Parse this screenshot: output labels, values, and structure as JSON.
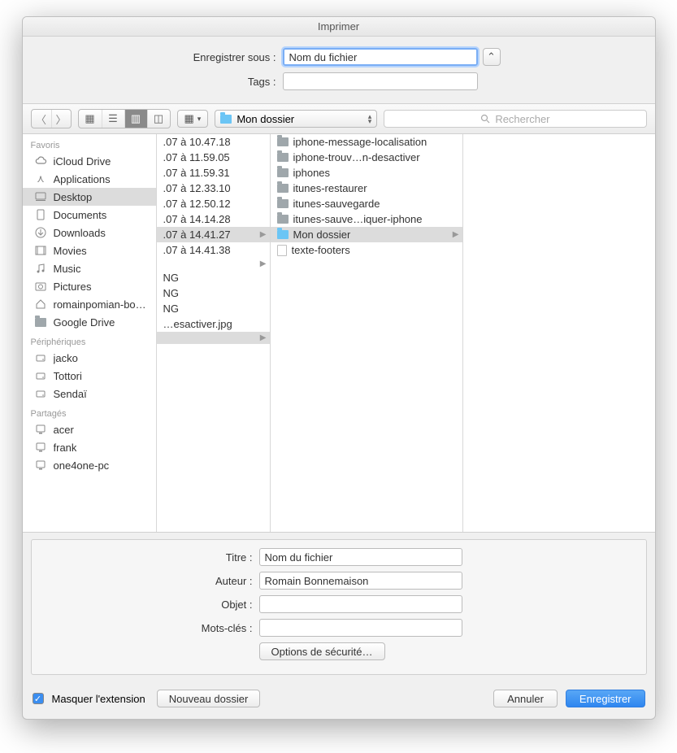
{
  "window": {
    "title": "Imprimer"
  },
  "save": {
    "label": "Enregistrer sous :",
    "filename": "Nom du fichier",
    "tags_label": "Tags :",
    "tags_value": ""
  },
  "toolbar": {
    "current_folder": "Mon dossier",
    "search_placeholder": "Rechercher"
  },
  "sidebar": {
    "sections": [
      {
        "heading": "Favoris",
        "items": [
          {
            "icon": "cloud",
            "label": "iCloud Drive"
          },
          {
            "icon": "apps",
            "label": "Applications"
          },
          {
            "icon": "desktop",
            "label": "Desktop",
            "selected": true
          },
          {
            "icon": "doc",
            "label": "Documents"
          },
          {
            "icon": "download",
            "label": "Downloads"
          },
          {
            "icon": "movie",
            "label": "Movies"
          },
          {
            "icon": "music",
            "label": "Music"
          },
          {
            "icon": "photo",
            "label": "Pictures"
          },
          {
            "icon": "home",
            "label": "romainpomian-bonne…"
          },
          {
            "icon": "folder",
            "label": "Google Drive"
          }
        ]
      },
      {
        "heading": "Périphériques",
        "items": [
          {
            "icon": "disk",
            "label": "jacko"
          },
          {
            "icon": "disk",
            "label": "Tottori"
          },
          {
            "icon": "disk",
            "label": "Sendaï"
          }
        ]
      },
      {
        "heading": "Partagés",
        "items": [
          {
            "icon": "pc",
            "label": "acer"
          },
          {
            "icon": "pc",
            "label": "frank"
          },
          {
            "icon": "pc",
            "label": "one4one-pc"
          }
        ]
      }
    ]
  },
  "column1": [
    {
      "label": ".07 à 10.47.18"
    },
    {
      "label": ".07 à 11.59.05"
    },
    {
      "label": ".07 à 11.59.31"
    },
    {
      "label": ".07 à 12.33.10"
    },
    {
      "label": ".07 à 12.50.12"
    },
    {
      "label": ".07 à 14.14.28"
    },
    {
      "label": ".07 à 14.41.27",
      "selected": true,
      "arrow": true
    },
    {
      "label": ".07 à 14.41.38"
    },
    {
      "label": "",
      "arrow": true
    },
    {
      "label": "NG"
    },
    {
      "label": "NG"
    },
    {
      "label": "NG"
    },
    {
      "label": "…esactiver.jpg"
    },
    {
      "label": "",
      "selected": true,
      "arrow": true
    }
  ],
  "column2": [
    {
      "icon": "folder",
      "label": "iphone-message-localisation"
    },
    {
      "icon": "folder",
      "label": "iphone-trouv…n-desactiver"
    },
    {
      "icon": "folder",
      "label": "iphones"
    },
    {
      "icon": "folder",
      "label": "itunes-restaurer"
    },
    {
      "icon": "folder",
      "label": "itunes-sauvegarde"
    },
    {
      "icon": "folder",
      "label": "itunes-sauve…iquer-iphone"
    },
    {
      "icon": "folder-blue",
      "label": "Mon dossier",
      "selected": true,
      "arrow": true
    },
    {
      "icon": "doc",
      "label": "texte-footers"
    }
  ],
  "meta": {
    "title_label": "Titre :",
    "title_value": "Nom du fichier",
    "author_label": "Auteur :",
    "author_value": "Romain Bonnemaison",
    "subject_label": "Objet :",
    "subject_value": "",
    "keywords_label": "Mots-clés :",
    "keywords_value": "",
    "security_btn": "Options de sécurité…"
  },
  "bottom": {
    "hide_ext_label": "Masquer l'extension",
    "new_folder": "Nouveau dossier",
    "cancel": "Annuler",
    "save": "Enregistrer"
  }
}
